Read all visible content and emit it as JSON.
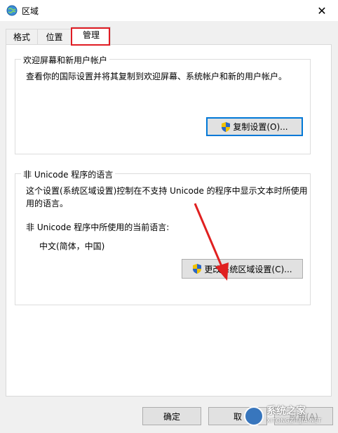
{
  "window": {
    "title": "区域",
    "close_symbol": "✕"
  },
  "tabs": [
    {
      "label": "格式",
      "active": false
    },
    {
      "label": "位置",
      "active": false
    },
    {
      "label": "管理",
      "active": true
    }
  ],
  "welcome_group": {
    "legend": "欢迎屏幕和新用户帐户",
    "description": "查看你的国际设置并将其复制到欢迎屏幕、系统帐户和新的用户帐户。",
    "button_label": "复制设置(O)..."
  },
  "unicode_group": {
    "legend": "非 Unicode 程序的语言",
    "description_line1": "这个设置(系统区域设置)控制在不支持 Unicode 的程序中显示文本时所使用",
    "description_line2": "用的语言。",
    "current_label": "非 Unicode 程序中所使用的当前语言:",
    "current_value": "中文(简体，中国)",
    "button_label": "更改系统区域设置(C)..."
  },
  "footer": {
    "ok_label": "确定",
    "cancel_label": "取",
    "apply_label": "应用(A)"
  },
  "watermark": {
    "title": "系统之家",
    "subtitle": "XITONGZHIJIA.NET"
  },
  "colors": {
    "accent": "#0078d7",
    "highlight": "#e01c24",
    "annotation_arrow": "#e02020"
  },
  "icons": [
    "globe-icon",
    "close-icon",
    "shield-icon",
    "arrow-annotation"
  ]
}
